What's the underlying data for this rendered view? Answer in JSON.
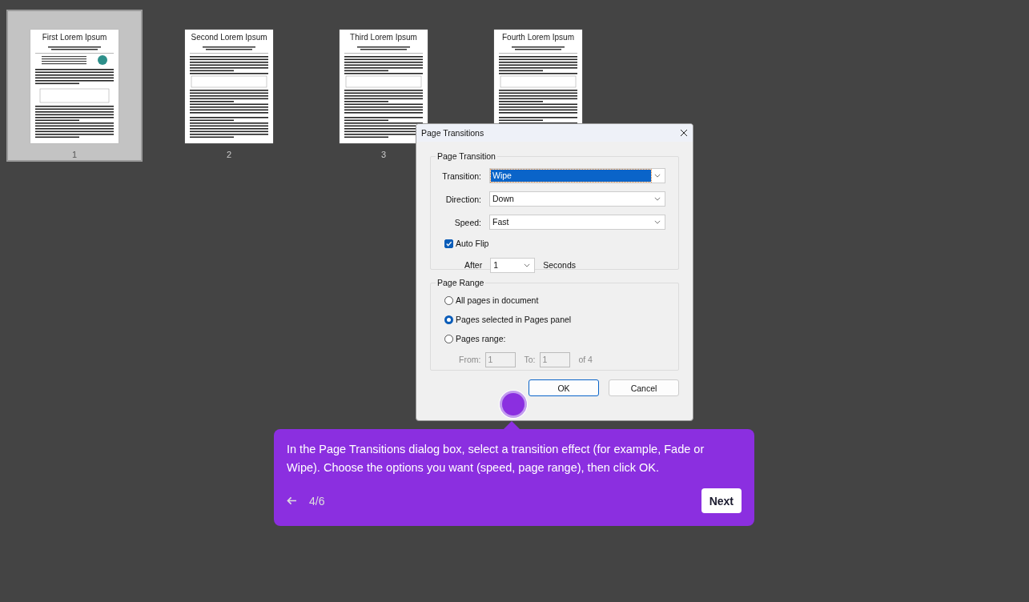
{
  "pages": [
    {
      "title": "First Lorem Ipsum",
      "number": "1",
      "selected": true,
      "kind": "figure"
    },
    {
      "title": "Second Lorem Ipsum",
      "number": "2",
      "selected": false,
      "kind": "table"
    },
    {
      "title": "Third Lorem Ipsum",
      "number": "3",
      "selected": false,
      "kind": "table"
    },
    {
      "title": "Fourth Lorem Ipsum",
      "selected": false,
      "kind": "table"
    }
  ],
  "dialog": {
    "title": "Page Transitions",
    "transition_group": {
      "title": "Page Transition",
      "fields": [
        {
          "label": "Transition:",
          "value": "Wipe",
          "focused": true
        },
        {
          "label": "Direction:",
          "value": "Down",
          "focused": false
        },
        {
          "label": "Speed:",
          "value": "Fast",
          "focused": false
        }
      ],
      "auto_flip": {
        "label": "Auto Flip",
        "checked": true
      },
      "after": {
        "label": "After",
        "value": "1",
        "unit": "Seconds"
      }
    },
    "range_group": {
      "title": "Page Range",
      "options": [
        {
          "label": "All pages in document",
          "selected": false
        },
        {
          "label": "Pages selected in Pages panel",
          "selected": true
        },
        {
          "label": "Pages range:",
          "selected": false
        }
      ],
      "from": {
        "label": "From:",
        "value": "1",
        "disabled": true
      },
      "to": {
        "label": "To:",
        "value": "1",
        "disabled": true
      },
      "of": "of 4"
    },
    "buttons": [
      {
        "label": "OK",
        "default": true
      },
      {
        "label": "Cancel",
        "default": false
      }
    ]
  },
  "tooltip": {
    "text": "In the Page Transitions dialog box, select a transition effect (for example, Fade or Wipe). Choose the options you want (speed, page range), then click OK.",
    "step": "4/6",
    "next": "Next"
  }
}
